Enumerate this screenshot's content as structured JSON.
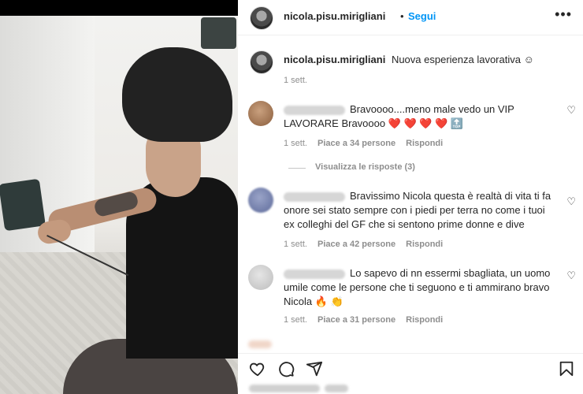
{
  "post": {
    "username": "nicola.pisu.mirigliani",
    "follow_label": "Segui",
    "separator": "•",
    "more_label": "•••",
    "caption": "Nuova esperienza lavorativa ☺",
    "caption_time": "1 sett."
  },
  "comments": [
    {
      "text": "Bravoooo....meno male vedo un VIP LAVORARE Bravoooo ❤️ ❤️ ❤️ ❤️ 🔝",
      "time": "1 sett.",
      "likes": "Piace a 34 persone",
      "reply": "Rispondi",
      "view_replies": "Visualizza le risposte (3)"
    },
    {
      "text": "Bravissimo Nicola questa è realtà di vita ti fa onore sei stato sempre con i piedi per terra no come i tuoi ex colleghi del GF che si sentono prime donne e dive",
      "time": "1 sett.",
      "likes": "Piace a 42 persone",
      "reply": "Rispondi"
    },
    {
      "text": "Lo sapevo di nn essermi sbagliata, un uomo umile come le persone che ti seguono e ti ammirano bravo Nicola 🔥 👏",
      "time": "1 sett.",
      "likes": "Piace a 31 persone",
      "reply": "Rispondi"
    }
  ],
  "icons": {
    "like": "heart-icon",
    "comment": "comment-icon",
    "share": "share-icon",
    "save": "bookmark-icon"
  },
  "colors": {
    "accent": "#0095f6",
    "muted": "#8e8e8e",
    "text": "#262626"
  }
}
